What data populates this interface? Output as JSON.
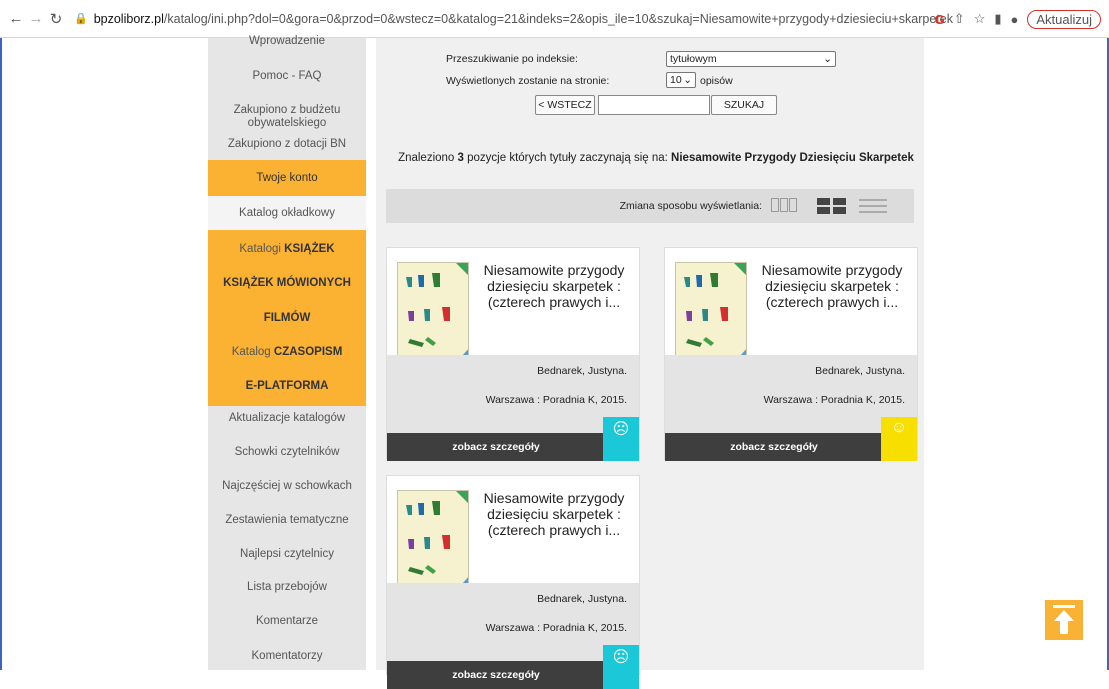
{
  "browser": {
    "url_host": "bpzoliborz.pl",
    "url_path": "/katalog/ini.php?dol=0&gora=0&przod=0&wstecz=0&katalog=21&indeks=2&opis_ile=10&szukaj=Niesamowite+przygody+dziesieciu+skarpetek",
    "update_label": "Aktualizuj"
  },
  "sidebar": {
    "items": [
      {
        "label": "Wprowadzenie"
      },
      {
        "label": "Pomoc - FAQ"
      },
      {
        "label": "Zakupiono z budżetu obywatelskiego"
      },
      {
        "label": "Zakupiono z dotacji BN"
      },
      {
        "label": "Twoje konto"
      },
      {
        "label": "Katalog okładkowy"
      },
      {
        "label_prefix": "Katalogi ",
        "label_bold": "KSIĄŻEK"
      },
      {
        "label": "KSIĄŻEK MÓWIONYCH"
      },
      {
        "label": "FILMÓW"
      },
      {
        "label_prefix": "Katalog ",
        "label_bold": "CZASOPISM"
      },
      {
        "label": "E-PLATFORMA"
      },
      {
        "label": "Aktualizacje katalogów"
      },
      {
        "label": "Schowki czytelników"
      },
      {
        "label": "Najczęściej w schowkach"
      },
      {
        "label": "Zestawienia tematyczne"
      },
      {
        "label": "Najlepsi czytelnicy"
      },
      {
        "label": "Lista przebojów"
      },
      {
        "label": "Komentarze"
      },
      {
        "label": "Komentatorzy"
      }
    ]
  },
  "search": {
    "index_label": "Przeszukiwanie po indeksie:",
    "index_value": "tytułowym",
    "per_page_label": "Wyświetlonych zostanie na stronie:",
    "per_page_value": "10",
    "per_page_suffix": "opisów",
    "back_button": "< WSTECZ",
    "search_button": "SZUKAJ",
    "input_value": ""
  },
  "results": {
    "prefix": "Znaleziono",
    "count": "3",
    "middle": "pozycje których tytuły zaczynają się na:",
    "query": "Niesamowite Przygody Dziesięciu Skarpetek"
  },
  "view": {
    "label": "Zmiana sposobu wyświetlania:"
  },
  "cards": [
    {
      "title": "Niesamowite przygody dziesięciu skarpetek : (czterech prawych i...",
      "author": "Bednarek, Justyna.",
      "publisher": "Warszawa : Poradnia K, 2015.",
      "details_label": "zobacz szczegóły",
      "status_color": "#1ac8d8",
      "status_icon": "sad-face-icon",
      "status_glyph": "☹"
    },
    {
      "title": "Niesamowite przygody dziesięciu skarpetek : (czterech prawych i...",
      "author": "Bednarek, Justyna.",
      "publisher": "Warszawa : Poradnia K, 2015.",
      "details_label": "zobacz szczegóły",
      "status_color": "#f7df00",
      "status_icon": "happy-face-icon",
      "status_glyph": "☺"
    },
    {
      "title": "Niesamowite przygody dziesięciu skarpetek : (czterech prawych i...",
      "author": "Bednarek, Justyna.",
      "publisher": "Warszawa : Poradnia K, 2015.",
      "details_label": "zobacz szczegóły",
      "status_color": "#1ac8d8",
      "status_icon": "sad-face-icon",
      "status_glyph": "☹"
    }
  ],
  "colors": {
    "sidebar_bg": "#e6e6e6",
    "accent_orange": "#fbb232",
    "main_bg": "#f0f0f0",
    "details_bar": "#3e3e3e"
  }
}
